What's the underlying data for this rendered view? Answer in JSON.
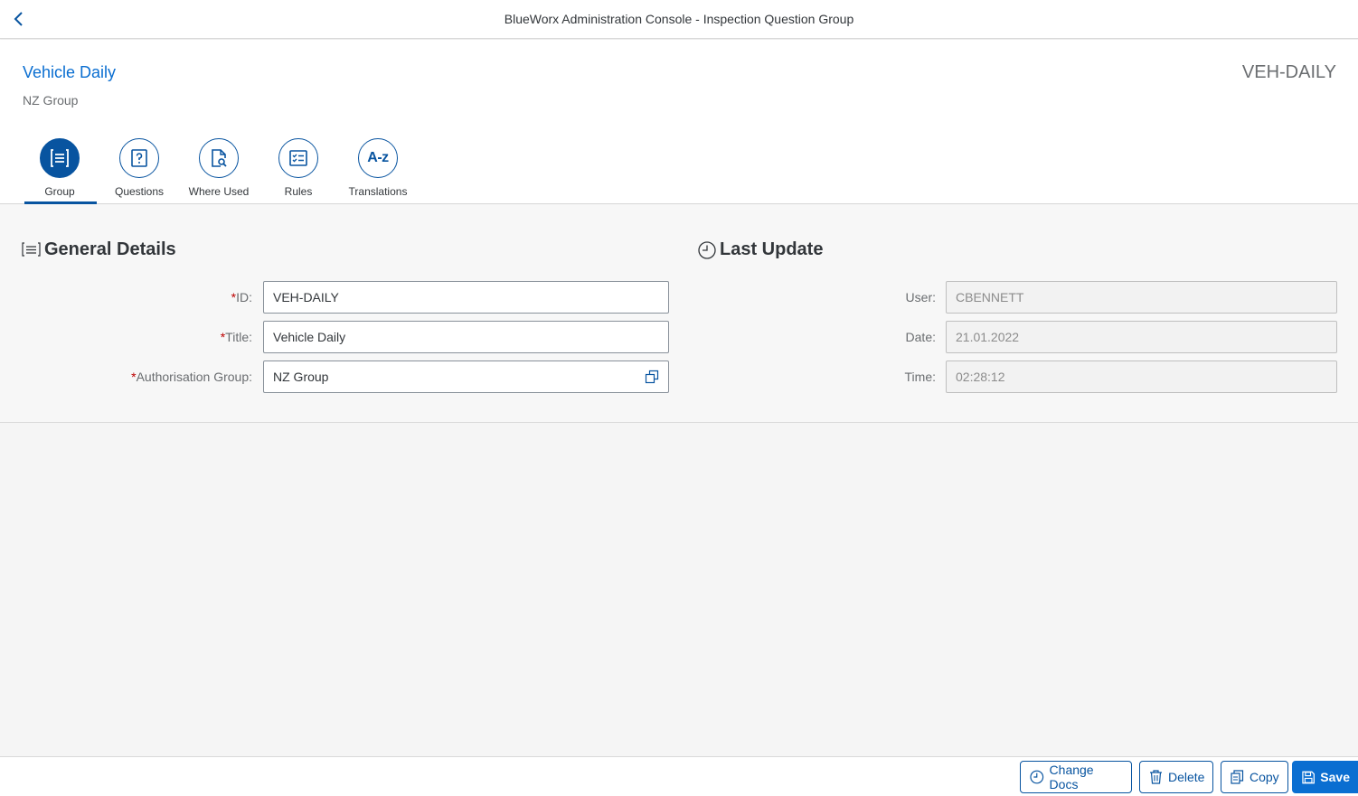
{
  "shell": {
    "title": "BlueWorx Administration Console - Inspection Question Group",
    "back_icon": "chevron-left-icon"
  },
  "header": {
    "title": "Vehicle Daily",
    "subtitle": "NZ Group",
    "number": "VEH-DAILY"
  },
  "tabs": [
    {
      "label": "Group",
      "icon": "form-icon",
      "active": true
    },
    {
      "label": "Questions",
      "icon": "question-mark-icon",
      "active": false
    },
    {
      "label": "Where Used",
      "icon": "document-search-icon",
      "active": false
    },
    {
      "label": "Rules",
      "icon": "checklist-icon",
      "active": false
    },
    {
      "label": "Translations",
      "icon": "a-z-icon",
      "active": false,
      "icon_text": "A-z"
    }
  ],
  "general": {
    "title": "General Details",
    "required_mark": "*",
    "id_label": "ID:",
    "id_value": "VEH-DAILY",
    "title_label": "Title:",
    "title_value": "Vehicle Daily",
    "auth_label": "Authorisation Group:",
    "auth_value": "NZ Group"
  },
  "last_update": {
    "title": "Last Update",
    "user_label": "User:",
    "user_value": "CBENNETT",
    "date_label": "Date:",
    "date_value": "21.01.2022",
    "time_label": "Time:",
    "time_value": "02:28:12"
  },
  "footer": {
    "change_docs": "Change Docs",
    "delete": "Delete",
    "copy": "Copy",
    "save": "Save"
  },
  "colors": {
    "brand": "#0854a0",
    "accent": "#0a6ed1",
    "required": "#bb0000"
  }
}
